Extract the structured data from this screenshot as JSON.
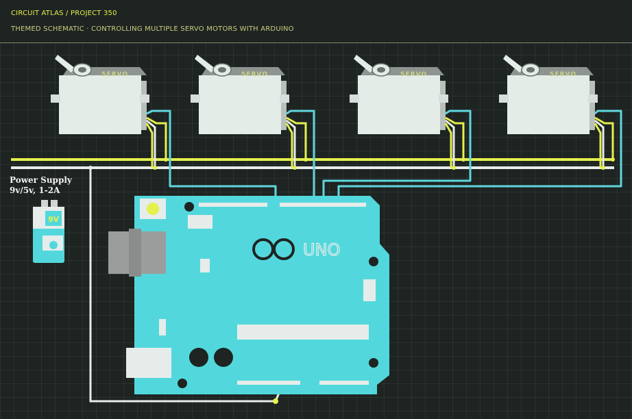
{
  "header": {
    "breadcrumb": "CIRCUIT ATLAS / PROJECT 350",
    "subtitle": "THEMED SCHEMATIC · CONTROLLING MULTIPLE SERVO MOTORS WITH ARDUINO"
  },
  "power_supply": {
    "label_line1": "Power Supply",
    "label_line2": "9v/5v, 1-2A",
    "battery_text": "9V"
  },
  "servos": [
    {
      "label": "SERVO"
    },
    {
      "label": "SERVO"
    },
    {
      "label": "SERVO"
    },
    {
      "label": "SERVO"
    }
  ],
  "board": {
    "logo_text": "UNO"
  },
  "colors": {
    "power_wire": "#e4f04c",
    "ground_wire": "#e6ecea",
    "signal_wire": "#5fd7de",
    "board": "#52d8dc"
  }
}
